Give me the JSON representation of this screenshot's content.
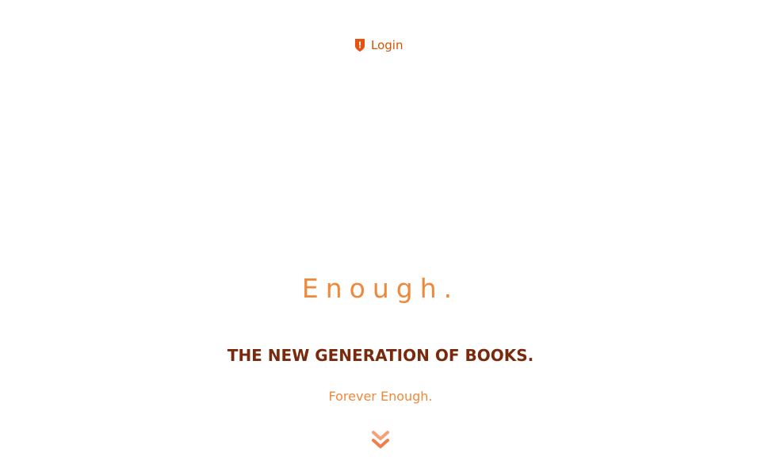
{
  "header": {
    "login_label": "Login",
    "login_icon": "shield-icon"
  },
  "hero": {
    "brand": "Enough.",
    "headline": "THE NEW GENERATION OF BOOKS.",
    "tagline": "Forever Enough.",
    "scroll_icon": "double-chevron-down-icon"
  },
  "colors": {
    "accent": "#f0883a",
    "accent_dark": "#d35400",
    "headline": "#7a2a0c",
    "background": "#ffffff"
  }
}
